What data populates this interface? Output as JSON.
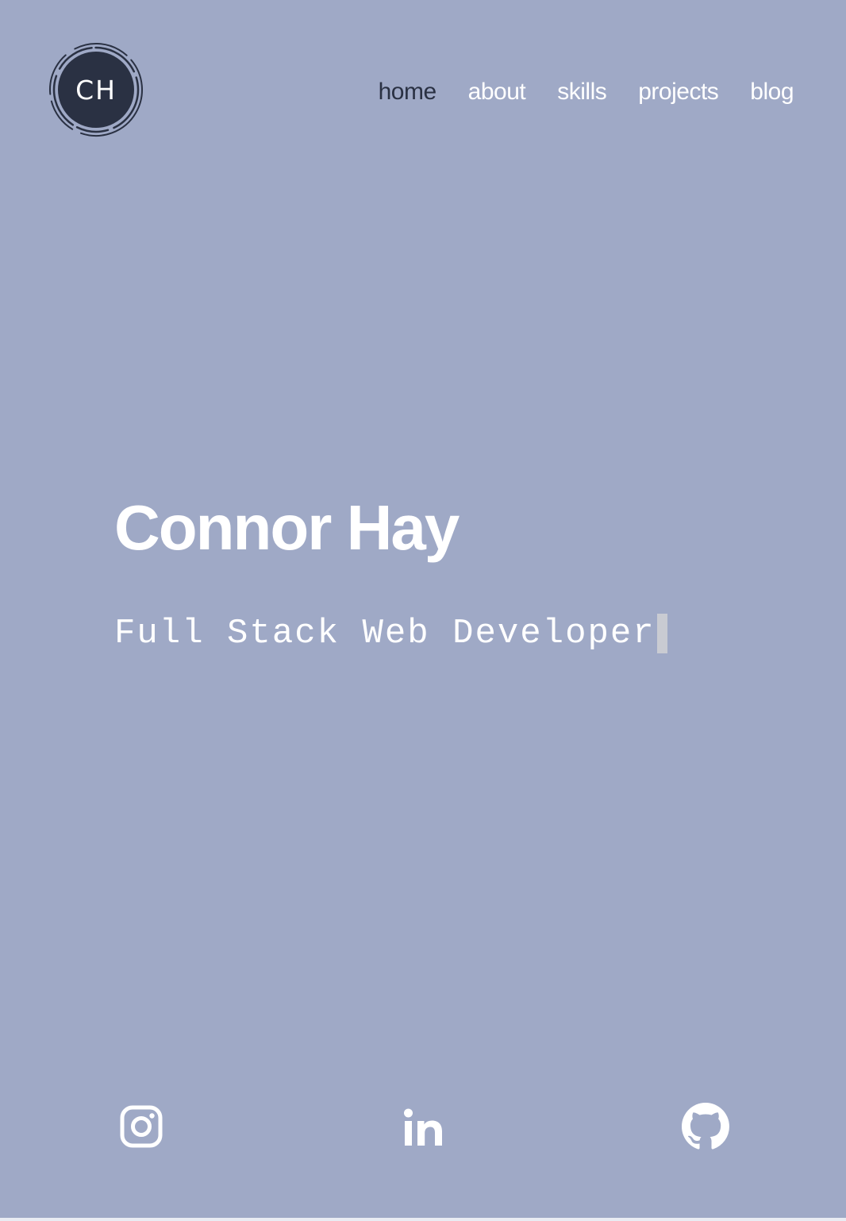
{
  "logo": {
    "text": "CH"
  },
  "nav": {
    "items": [
      {
        "label": "home",
        "active": true
      },
      {
        "label": "about",
        "active": false
      },
      {
        "label": "skills",
        "active": false
      },
      {
        "label": "projects",
        "active": false
      },
      {
        "label": "blog",
        "active": false
      }
    ]
  },
  "hero": {
    "name": "Connor Hay",
    "role": "Full Stack Web Developer"
  },
  "social": {
    "icons": [
      "instagram-icon",
      "linkedin-icon",
      "github-icon"
    ]
  },
  "colors": {
    "background": "#9fa9c6",
    "text": "#ffffff",
    "active_nav": "#2a3143",
    "logo_fill": "#2a3143",
    "cursor": "#c9cbd2"
  }
}
